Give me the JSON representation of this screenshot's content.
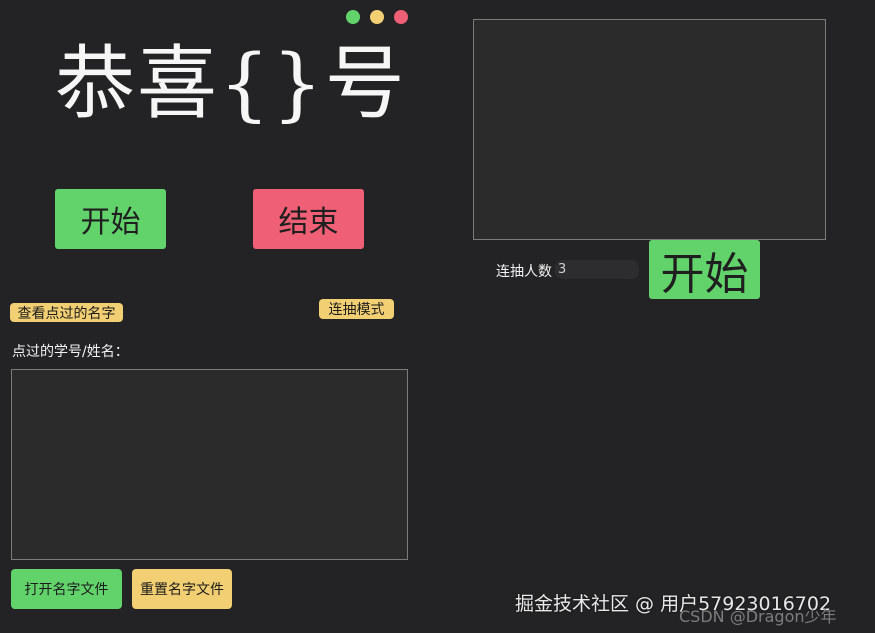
{
  "window": {
    "controls": [
      {
        "name": "maximize",
        "color": "#62d36b"
      },
      {
        "name": "minimize",
        "color": "#f2cf73"
      },
      {
        "name": "close",
        "color": "#ef5f75"
      }
    ]
  },
  "main": {
    "title": "恭喜{}号",
    "start_label": "开始",
    "stop_label": "结束",
    "view_names_label": "查看点过的名字",
    "multi_mode_label": "连抽模式",
    "history_label": "点过的学号/姓名：",
    "open_file_label": "打开名字文件",
    "reset_file_label": "重置名字文件"
  },
  "multi": {
    "count_label": "连抽人数",
    "count_value": "3",
    "start_label": "开始"
  },
  "watermark": {
    "line1": "掘金技术社区 @ 用户57923016702",
    "line2": "CSDN @Dragon少年"
  },
  "colors": {
    "background": "#232325",
    "green": "#62d36b",
    "red": "#ef5f75",
    "yellow": "#f2cf73"
  }
}
